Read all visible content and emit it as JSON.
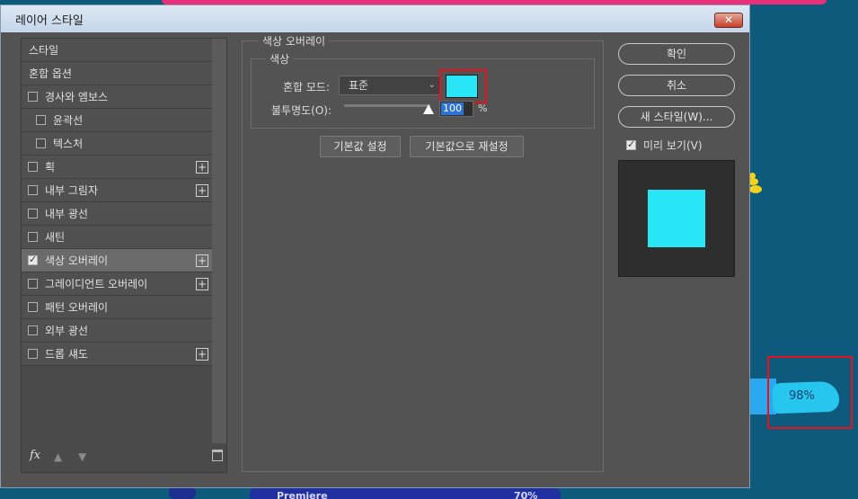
{
  "window": {
    "title": "레이어 스타일",
    "close_label": "✕"
  },
  "styles_list": {
    "items": [
      {
        "label": "스타일",
        "checkbox": false,
        "checked": false,
        "plus": false,
        "selected": false
      },
      {
        "label": "혼합 옵션",
        "checkbox": false,
        "checked": false,
        "plus": false,
        "selected": false
      },
      {
        "label": "경사와 엠보스",
        "checkbox": true,
        "checked": false,
        "plus": false,
        "selected": false
      },
      {
        "label": "윤곽선",
        "checkbox": true,
        "checked": false,
        "plus": false,
        "selected": false,
        "indent": true
      },
      {
        "label": "텍스처",
        "checkbox": true,
        "checked": false,
        "plus": false,
        "selected": false,
        "indent": true
      },
      {
        "label": "획",
        "checkbox": true,
        "checked": false,
        "plus": true,
        "selected": false
      },
      {
        "label": "내부 그림자",
        "checkbox": true,
        "checked": false,
        "plus": true,
        "selected": false
      },
      {
        "label": "내부 광선",
        "checkbox": true,
        "checked": false,
        "plus": false,
        "selected": false
      },
      {
        "label": "새틴",
        "checkbox": true,
        "checked": false,
        "plus": false,
        "selected": false
      },
      {
        "label": "색상 오버레이",
        "checkbox": true,
        "checked": true,
        "plus": true,
        "selected": true
      },
      {
        "label": "그레이디언트 오버레이",
        "checkbox": true,
        "checked": false,
        "plus": true,
        "selected": false
      },
      {
        "label": "패턴 오버레이",
        "checkbox": true,
        "checked": false,
        "plus": false,
        "selected": false
      },
      {
        "label": "외부 광선",
        "checkbox": true,
        "checked": false,
        "plus": false,
        "selected": false
      },
      {
        "label": "드롭 섀도",
        "checkbox": true,
        "checked": false,
        "plus": true,
        "selected": false
      }
    ],
    "footer": {
      "fx_label": "fx",
      "up_icon": "arrow-up-icon",
      "down_icon": "arrow-down-icon",
      "trash_icon": "trash-icon"
    }
  },
  "color_overlay": {
    "section_title": "색상 오버레이",
    "group_title": "색상",
    "blend_mode_label": "혼합 모드:",
    "blend_mode_value": "표준",
    "swatch_color": "#29e6f7",
    "opacity_label": "불투명도(O):",
    "opacity_value": "100",
    "opacity_unit": "%",
    "opacity_level": 1.0,
    "default_button": "기본값 설정",
    "reset_button": "기본값으로 재설정"
  },
  "actions": {
    "ok": "확인",
    "cancel": "취소",
    "new_style": "새 스타일(W)...",
    "preview_label": "미리 보기(V)",
    "preview_checked": true,
    "preview_color": "#29e6f7"
  },
  "background": {
    "percent_label": "98%",
    "bottom_label": "Premiere",
    "bottom_percent": "70%"
  }
}
